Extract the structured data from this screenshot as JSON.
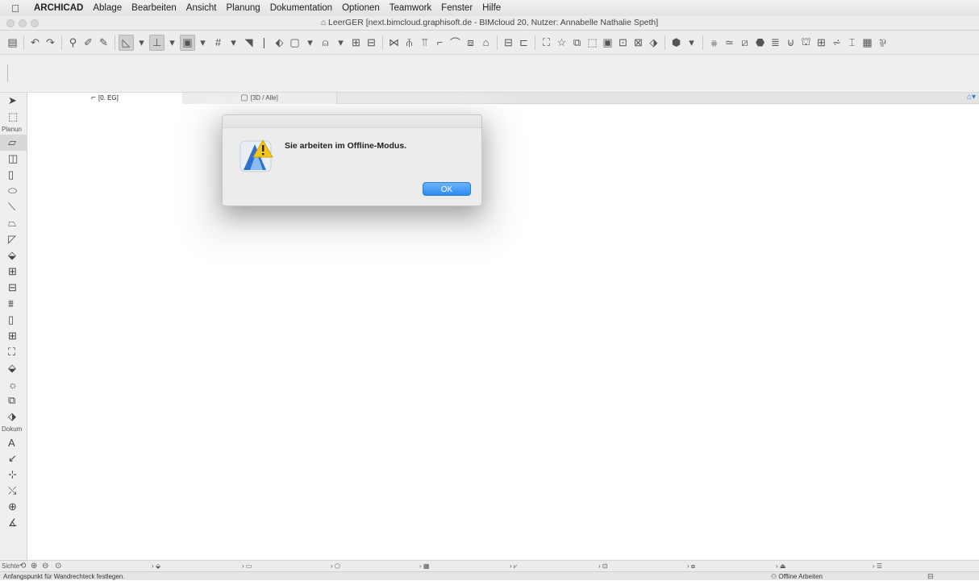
{
  "menubar": {
    "apple_icon": "apple-icon",
    "items": [
      "ARCHICAD",
      "Ablage",
      "Bearbeiten",
      "Ansicht",
      "Planung",
      "Dokumentation",
      "Optionen",
      "Teamwork",
      "Fenster",
      "Hilfe"
    ]
  },
  "window": {
    "title": "LeerGER [next.bimcloud.graphisoft.de - BIMcloud 20, Nutzer: Annabelle Nathalie Speth]"
  },
  "toolbar": {
    "icons": [
      "save-icon",
      "undo-icon",
      "redo-icon",
      "pick-up-icon",
      "pipette-icon",
      "inject-icon",
      "arrow-select-icon",
      "dropdown-icon",
      "ruler-icon",
      "dropdown-icon",
      "gravity-icon",
      "dropdown-icon",
      "grid-icon",
      "dropdown-icon",
      "guide-icon",
      "snap-icon",
      "suspend-group-icon",
      "group-icon",
      "dropdown-icon",
      "lock-icon",
      "dropdown-icon",
      "align-icon",
      "distribute-icon",
      "trim-icon",
      "split-icon",
      "adjust-icon",
      "intersect-icon",
      "fillet-icon",
      "offset-icon",
      "explode-icon",
      "elevation-icon",
      "section-icon",
      "detail-icon",
      "favorite-icon",
      "layer-icon",
      "model-icon",
      "view-icon",
      "layout-icon",
      "publish-icon",
      "pen-icon",
      "3d-icon",
      "dropdown-icon",
      "stair-icon",
      "railing-icon",
      "curtain-icon",
      "morph-icon",
      "shell-icon",
      "roof-icon",
      "zone-icon",
      "mesh-icon",
      "beam-icon",
      "column-icon",
      "object-icon",
      "lamp-icon",
      "window-icon"
    ]
  },
  "toolbox": {
    "groups": [
      {
        "label": "Planung",
        "tools": [
          "wall-icon",
          "column-icon",
          "beam-icon",
          "slab-icon",
          "stair-icon",
          "railing-icon",
          "roof-icon",
          "shell-icon",
          "skylight-icon",
          "curtain-wall-icon",
          "door-icon",
          "window-icon",
          "object-icon",
          "zone-icon",
          "mesh-icon",
          "morph-icon",
          "lamp-icon",
          "section-icon"
        ]
      },
      {
        "label": "Dokumentation",
        "tools": [
          "text-icon",
          "label-icon",
          "dimension-icon",
          "level-dimension-icon",
          "radial-dimension-icon",
          "angle-dimension-icon"
        ]
      }
    ],
    "group_labels_visible": [
      "Planun",
      "Dokum"
    ]
  },
  "tabs": [
    {
      "label": "[0. EG]",
      "icon": "floor-plan-icon",
      "active": true
    },
    {
      "label": "[3D / Alle]",
      "icon": "3d-view-icon",
      "active": false
    }
  ],
  "dialog": {
    "message": "Sie arbeiten im Offline-Modus.",
    "ok_label": "OK",
    "icon": "archicad-warning-icon"
  },
  "navbar": {
    "left_label": "Sichte",
    "items": [
      "layer-combo-icon",
      "scale-icon",
      "structural-icon",
      "pen-set-icon",
      "mvo-icon",
      "override-icon",
      "renovation-icon",
      "zoom-icon",
      "partial-icon"
    ]
  },
  "status": {
    "message": "Anfangspunkt für Wandrechteck festlegen.",
    "offline": "Offline Arbeiten"
  }
}
